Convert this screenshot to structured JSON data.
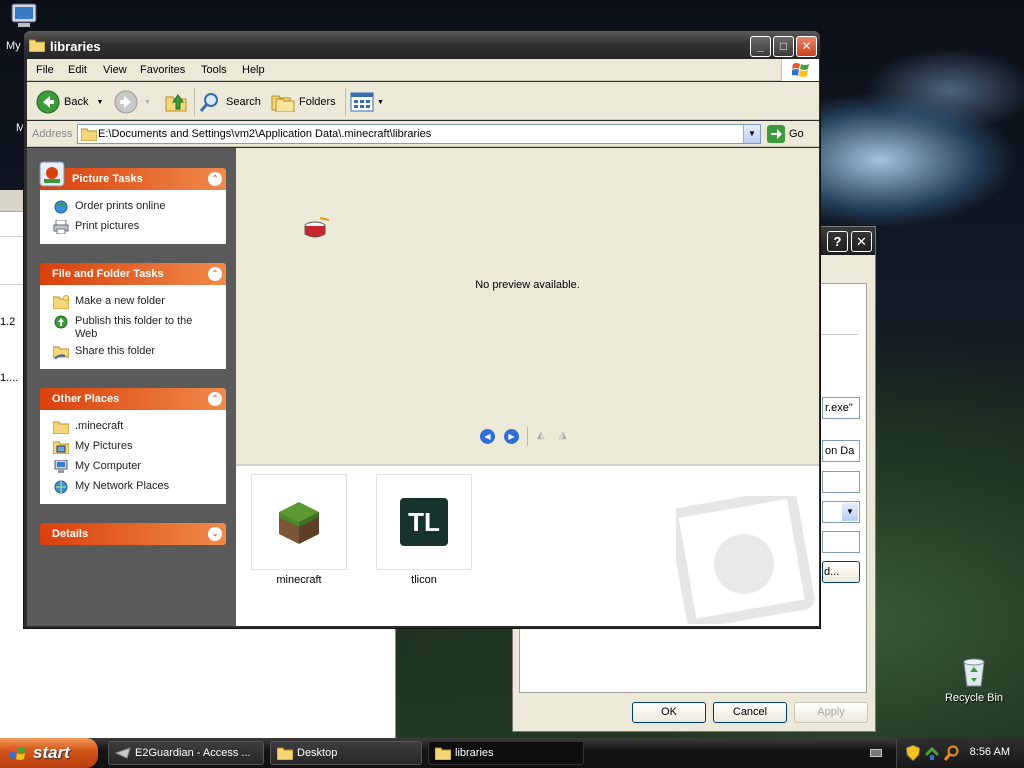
{
  "desktop": {
    "icons": {
      "my_computer": "My",
      "my_docs_partial": "M",
      "recycle_bin": "Recycle Bin"
    }
  },
  "bg_window_left": {
    "line1": "1.2",
    "line2": "1...."
  },
  "dialog": {
    "help_btn": "?",
    "close_btn": "✕",
    "field1": "r.exe\"",
    "field2": "on Da",
    "button_partial": "d...",
    "ok": "OK",
    "cancel": "Cancel",
    "apply": "Apply"
  },
  "window": {
    "title": "libraries",
    "controls": {
      "minimize": "_",
      "maximize": "□",
      "close": "✕"
    },
    "menu": [
      "File",
      "Edit",
      "View",
      "Favorites",
      "Tools",
      "Help"
    ],
    "toolbar": {
      "back": "Back",
      "search": "Search",
      "folders": "Folders"
    },
    "address": {
      "label": "Address",
      "path": "E:\\Documents and Settings\\vm2\\Application Data\\.minecraft\\libraries",
      "go": "Go"
    },
    "tasks": {
      "picture": {
        "title": "Picture Tasks",
        "items": [
          "Order prints online",
          "Print pictures"
        ]
      },
      "file_folder": {
        "title": "File and Folder Tasks",
        "items": [
          "Make a new folder",
          "Publish this folder to the Web",
          "Share this folder"
        ]
      },
      "other": {
        "title": "Other Places",
        "items": [
          ".minecraft",
          "My Pictures",
          "My Computer",
          "My Network Places"
        ]
      },
      "details": {
        "title": "Details"
      }
    },
    "preview": {
      "message": "No preview available."
    },
    "files": [
      {
        "name": "minecraft"
      },
      {
        "name": "tlicon",
        "logo_text": "TL"
      }
    ]
  },
  "taskbar": {
    "start": "start",
    "buttons": [
      "E2Guardian - Access ...",
      "Desktop",
      "libraries"
    ],
    "clock": "8:56 AM"
  },
  "colors": {
    "task_header": "#d9400c",
    "tl_logo_bg": "#16332d",
    "window_frame": "#2c2c2c"
  }
}
